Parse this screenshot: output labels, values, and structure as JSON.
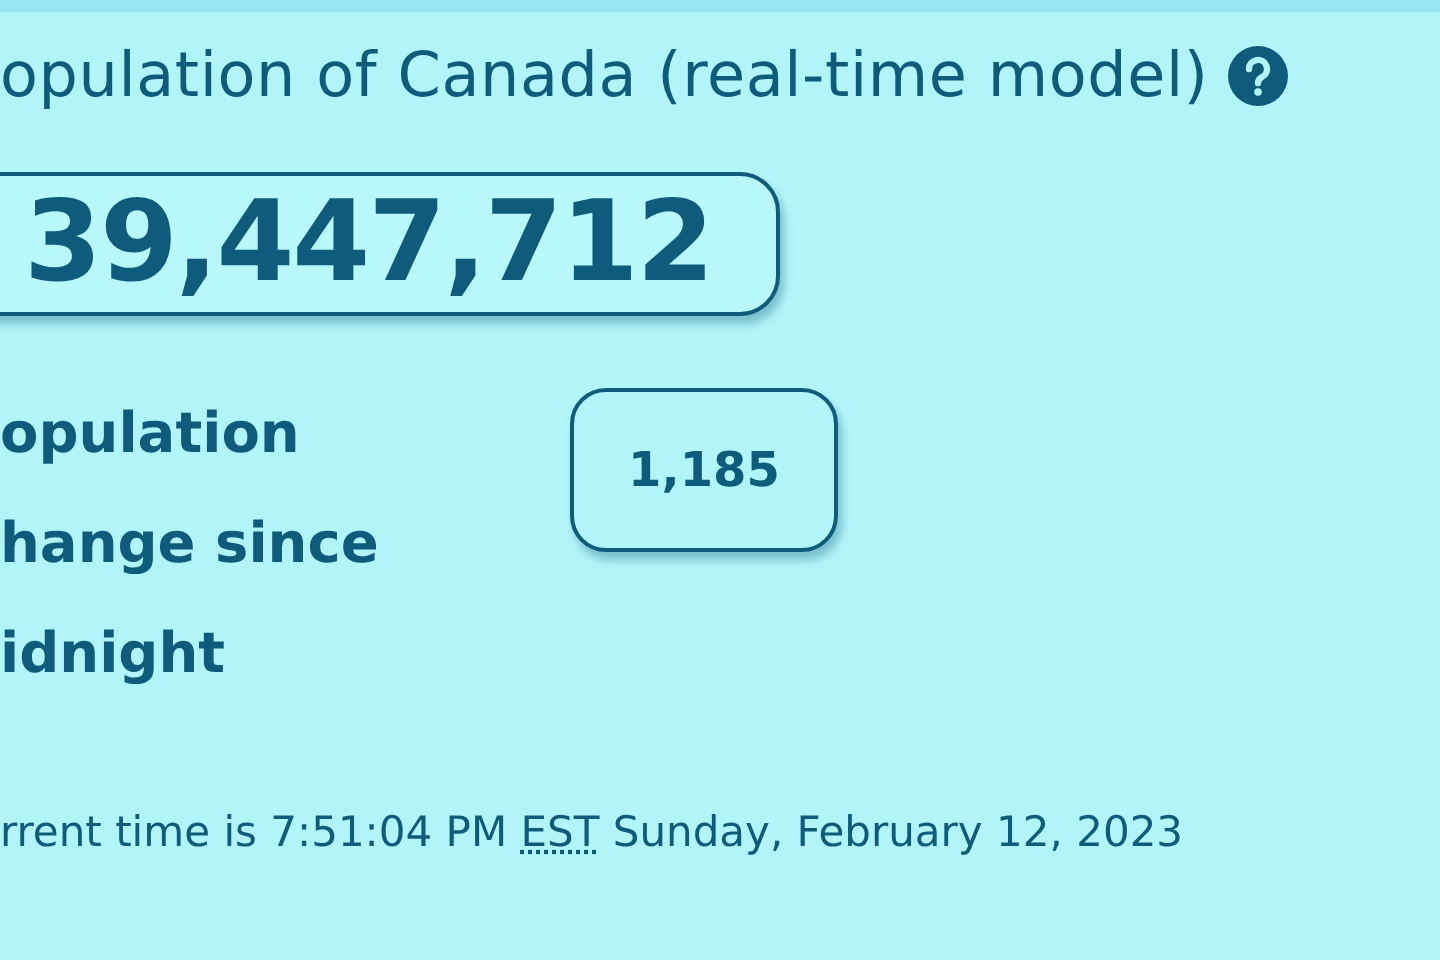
{
  "title": "opulation of Canada (real-time model)",
  "population": "39,447,712",
  "change": {
    "label_lines": [
      "opulation",
      "hange since",
      "idnight"
    ],
    "value": "1,185"
  },
  "current_time": {
    "before": "rrent time is 7:51:04 PM",
    "abbr": "EST",
    "after": "Sunday, February 12, 2023"
  }
}
